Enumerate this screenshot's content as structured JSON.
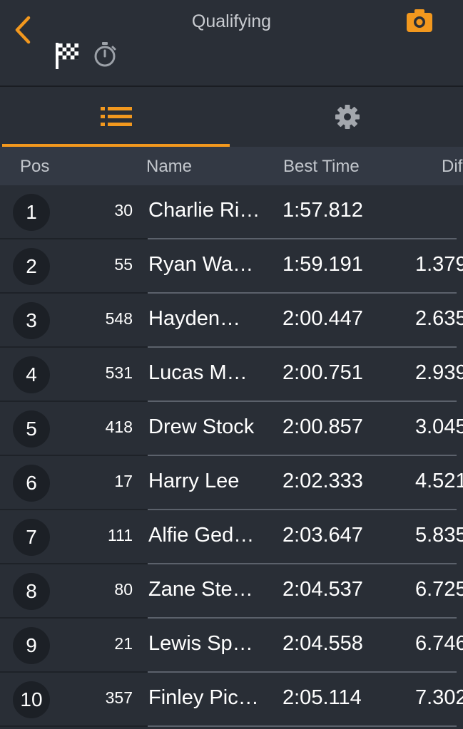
{
  "header": {
    "title": "Qualifying",
    "back_icon": "chevron-left-icon",
    "camera_icon": "camera-icon",
    "flag_icon": "checkered-flag-icon",
    "stopwatch_icon": "stopwatch-icon"
  },
  "tabs": [
    {
      "icon": "list-icon",
      "active": true
    },
    {
      "icon": "gear-icon",
      "active": false
    }
  ],
  "columns": {
    "pos": "Pos",
    "name": "Name",
    "best_time": "Best Time",
    "diff": "Dif"
  },
  "colors": {
    "accent": "#f2981e",
    "background": "#292e36",
    "header_row": "#333944"
  },
  "rows": [
    {
      "pos": "1",
      "num": "30",
      "name": "Charlie Ri…",
      "best": "1:57.812",
      "diff": ""
    },
    {
      "pos": "2",
      "num": "55",
      "name": "Ryan Wa…",
      "best": "1:59.191",
      "diff": "1.379"
    },
    {
      "pos": "3",
      "num": "548",
      "name": "Hayden…",
      "best": "2:00.447",
      "diff": "2.635"
    },
    {
      "pos": "4",
      "num": "531",
      "name": "Lucas M…",
      "best": "2:00.751",
      "diff": "2.939"
    },
    {
      "pos": "5",
      "num": "418",
      "name": "Drew Stock",
      "best": "2:00.857",
      "diff": "3.045"
    },
    {
      "pos": "6",
      "num": "17",
      "name": "Harry Lee",
      "best": "2:02.333",
      "diff": "4.521"
    },
    {
      "pos": "7",
      "num": "111",
      "name": "Alfie Ged…",
      "best": "2:03.647",
      "diff": "5.835"
    },
    {
      "pos": "8",
      "num": "80",
      "name": "Zane Ste…",
      "best": "2:04.537",
      "diff": "6.725"
    },
    {
      "pos": "9",
      "num": "21",
      "name": "Lewis Sp…",
      "best": "2:04.558",
      "diff": "6.746"
    },
    {
      "pos": "10",
      "num": "357",
      "name": "Finley Pic…",
      "best": "2:05.114",
      "diff": "7.302"
    }
  ]
}
